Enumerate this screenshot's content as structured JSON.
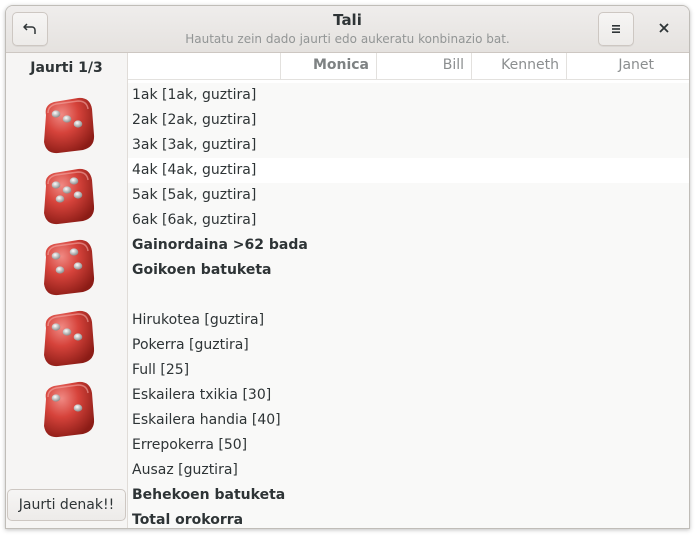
{
  "window": {
    "title": "Tali",
    "subtitle": "Hautatu zein dado jaurti edo aukeratu konbinazio bat."
  },
  "header": {
    "undo_icon": "↶",
    "menu_icon": "≡",
    "close_icon": "✕"
  },
  "sidebar": {
    "roll_label": "Jaurti 1/3",
    "roll_all_label": "Jaurti denak!!",
    "dice": [
      3,
      5,
      4,
      3,
      2
    ]
  },
  "players": [
    "Monica",
    "Bill",
    "Kenneth",
    "Janet"
  ],
  "categories": [
    {
      "label": "1ak [1ak, guztira]",
      "bold": false
    },
    {
      "label": "2ak [2ak, guztira]",
      "bold": false
    },
    {
      "label": "3ak [3ak, guztira]",
      "bold": false
    },
    {
      "label": "4ak [4ak, guztira]",
      "bold": false
    },
    {
      "label": "5ak [5ak, guztira]",
      "bold": false
    },
    {
      "label": "6ak [6ak, guztira]",
      "bold": false
    },
    {
      "label": "Gainordaina >62 bada",
      "bold": true
    },
    {
      "label": "Goikoen batuketa",
      "bold": true
    },
    {
      "label": "",
      "bold": false
    },
    {
      "label": "Hirukotea [guztira]",
      "bold": false
    },
    {
      "label": "Pokerra [guztira]",
      "bold": false
    },
    {
      "label": "Full [25]",
      "bold": false
    },
    {
      "label": "Eskailera txikia [30]",
      "bold": false
    },
    {
      "label": "Eskailera handia [40]",
      "bold": false
    },
    {
      "label": "Errepokerra [50]",
      "bold": false
    },
    {
      "label": "Ausaz [guztira]",
      "bold": false
    },
    {
      "label": "Behekoen batuketa",
      "bold": true
    },
    {
      "label": "Total orokorra",
      "bold": true
    }
  ]
}
